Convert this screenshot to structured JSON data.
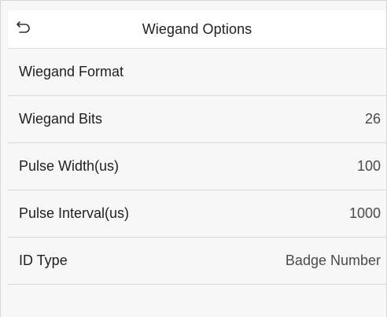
{
  "header": {
    "title": "Wiegand Options",
    "back_icon": "back-arrow-icon"
  },
  "rows": [
    {
      "label": "Wiegand Format",
      "value": ""
    },
    {
      "label": "Wiegand Bits",
      "value": "26"
    },
    {
      "label": "Pulse Width(us)",
      "value": "100"
    },
    {
      "label": "Pulse Interval(us)",
      "value": "1000"
    },
    {
      "label": "ID Type",
      "value": "Badge Number"
    }
  ],
  "colors": {
    "background": "#f7f7f7",
    "header_background": "#ffffff",
    "divider": "#d9d9d9",
    "text": "#1f1f1f"
  }
}
